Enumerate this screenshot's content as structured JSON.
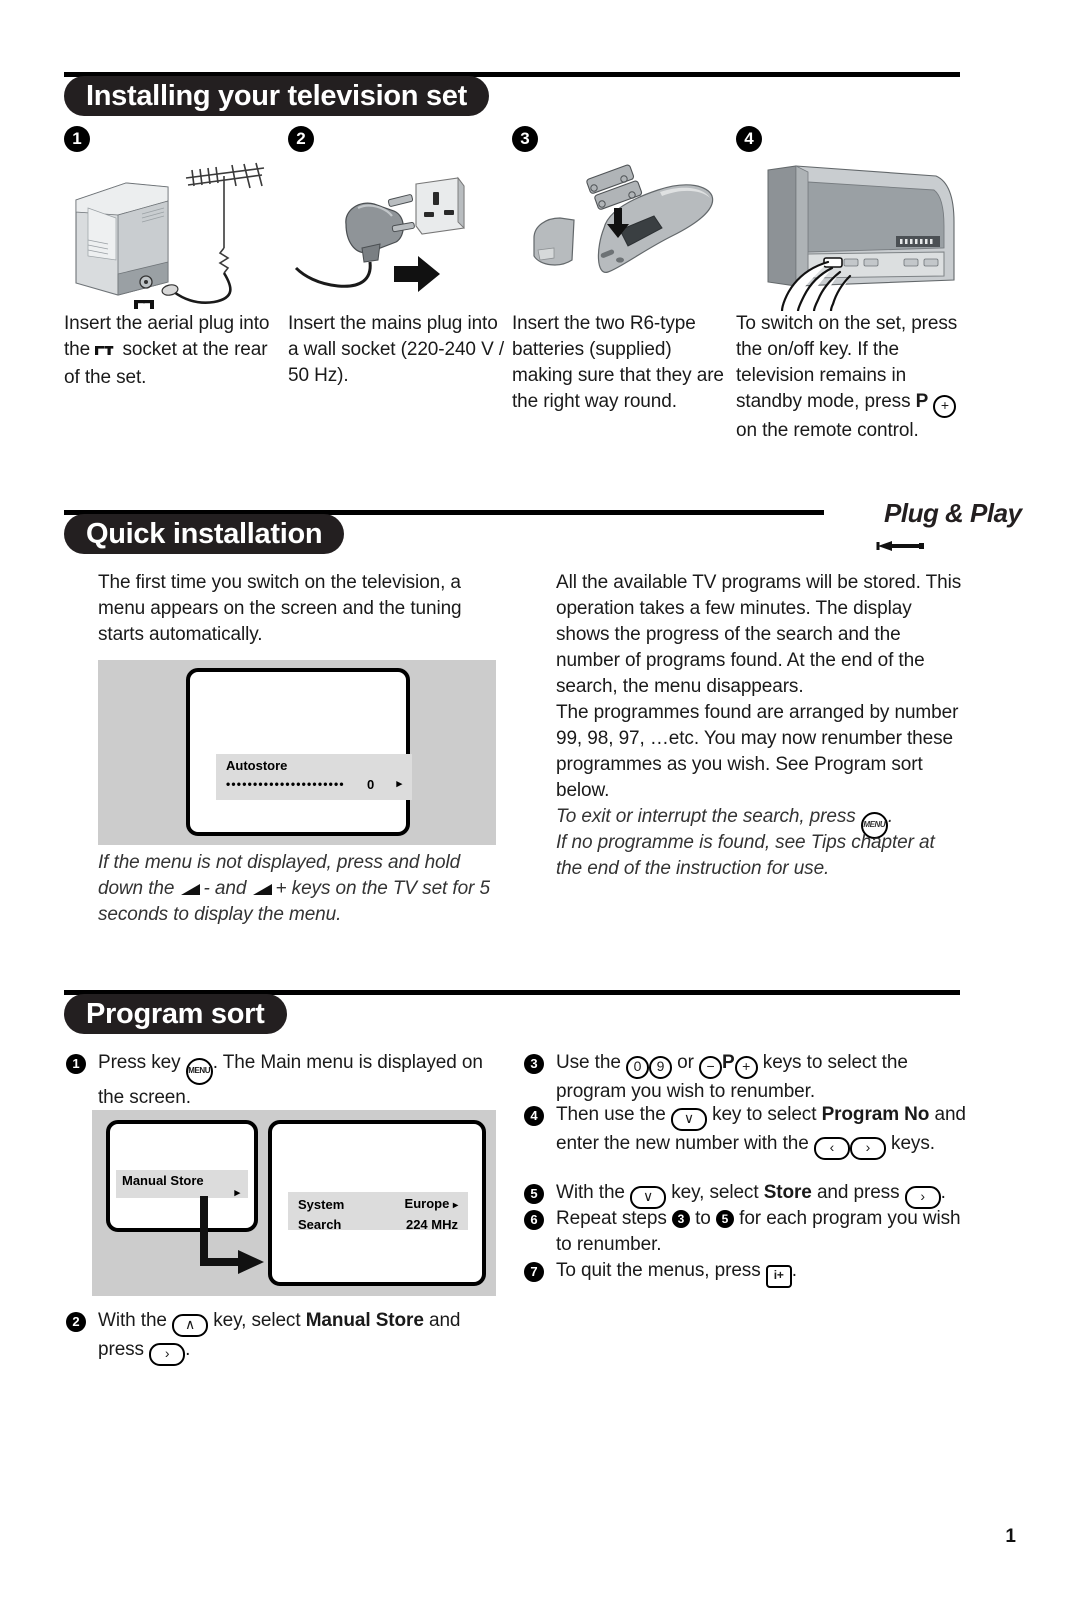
{
  "document": {
    "page_number": "1"
  },
  "sections": {
    "installing": {
      "title": "Installing your television set",
      "steps": [
        {
          "number": "1",
          "icon": "tv-with-aerial-illustration",
          "caption_part1": "Insert the aerial plug into the ",
          "aerial_symbol": "aerial-socket-symbol",
          "caption_part2": " socket at the rear of the set."
        },
        {
          "number": "2",
          "icon": "mains-plug-wall-socket-illustration",
          "caption_part1": "Insert the mains plug into a wall socket (220-240 V / 50 Hz).",
          "caption_part2": ""
        },
        {
          "number": "3",
          "icon": "remote-control-batteries-illustration",
          "caption_part1": "Insert the two R6-type batteries (supplied) making sure that they are the right way round.",
          "caption_part2": ""
        },
        {
          "number": "4",
          "icon": "hand-pressing-tv-onoff-illustration",
          "caption_part1": "To switch on the set, press the on/off key. If the television remains in standby mode, press ",
          "key_p": "P",
          "key_plus": "+",
          "caption_part2": " on the remote control."
        }
      ]
    },
    "quick_installation": {
      "title": "Quick installation",
      "logo": "Plug & Play",
      "left_paragraph": "The first time you switch on the television, a menu appears on the screen and the tuning starts automatically.",
      "osd": {
        "label": "Autostore",
        "progress_dots": "••••••••••••••••••••••",
        "value": "0",
        "arrow": "▸"
      },
      "left_note_part1": "If the menu is not displayed, press and hold down the ",
      "left_note_vol_minus": "-",
      "left_note_part2": " and ",
      "left_note_vol_plus": "+",
      "left_note_part3": " keys on the TV set for 5 seconds to display the menu.",
      "right_paragraph_1": "All the available TV programs will be stored. This operation takes a few minutes. The display shows the progress of the search and the number of programs found. At the end of the search, the menu disappears.",
      "right_paragraph_2": "The programmes found are arranged by number 99, 98, 97, …etc. You may now renumber these programmes as you wish. See Program sort below.",
      "right_note_1_part1": "To exit or interrupt the search, press ",
      "right_note_1_key": "MENU",
      "right_note_1_part2": ".",
      "right_note_2": "If no programme is found, see Tips chapter at the end of the instruction for use."
    },
    "program_sort": {
      "title": "Program sort",
      "step1": {
        "number": "1",
        "text_part1": "Press key ",
        "key": "MENU",
        "text_part2": ". The Main menu is displayed on the screen."
      },
      "osd_left": {
        "label": "Manual Store",
        "arrow": "▸"
      },
      "osd_right": {
        "rows": [
          {
            "label": "System",
            "value": "Europe",
            "arrow": "▸"
          },
          {
            "label": "Search",
            "value": "224 MHz",
            "arrow": ""
          }
        ]
      },
      "step2": {
        "number": "2",
        "text_part1": "With the ",
        "key_up": "∧",
        "text_part2": " key, select ",
        "bold": "Manual Store",
        "text_part3": " and press ",
        "key_right": "›",
        "text_part4": "."
      },
      "step3": {
        "number": "3",
        "text_part1": "Use the ",
        "key_0": "0",
        "key_9": "9",
        "text_part2": " or ",
        "key_minus": "−",
        "key_p": "P",
        "key_plus": "+",
        "text_part3": " keys to select the program you wish to renumber."
      },
      "step4": {
        "number": "4",
        "text_part1": "Then use the ",
        "key_down": "∨",
        "text_part2": " key to select ",
        "bold": "Program No",
        "text_part3": " and enter the new number with the ",
        "key_left": "‹",
        "key_right": "›",
        "text_part4": " keys."
      },
      "step5": {
        "number": "5",
        "text_part1": "With the ",
        "key_down": "∨",
        "text_part2": " key, select ",
        "bold": "Store",
        "text_part3": " and press ",
        "key_right": "›",
        "text_part4": "."
      },
      "step6": {
        "number": "6",
        "text_part1": "Repeat steps ",
        "from": "3",
        "text_part2": " to ",
        "to": "5",
        "text_part3": " for each program you wish to renumber."
      },
      "step7": {
        "number": "7",
        "text_part1": "To quit the menus, press ",
        "key": "i+",
        "text_part2": "."
      }
    }
  }
}
